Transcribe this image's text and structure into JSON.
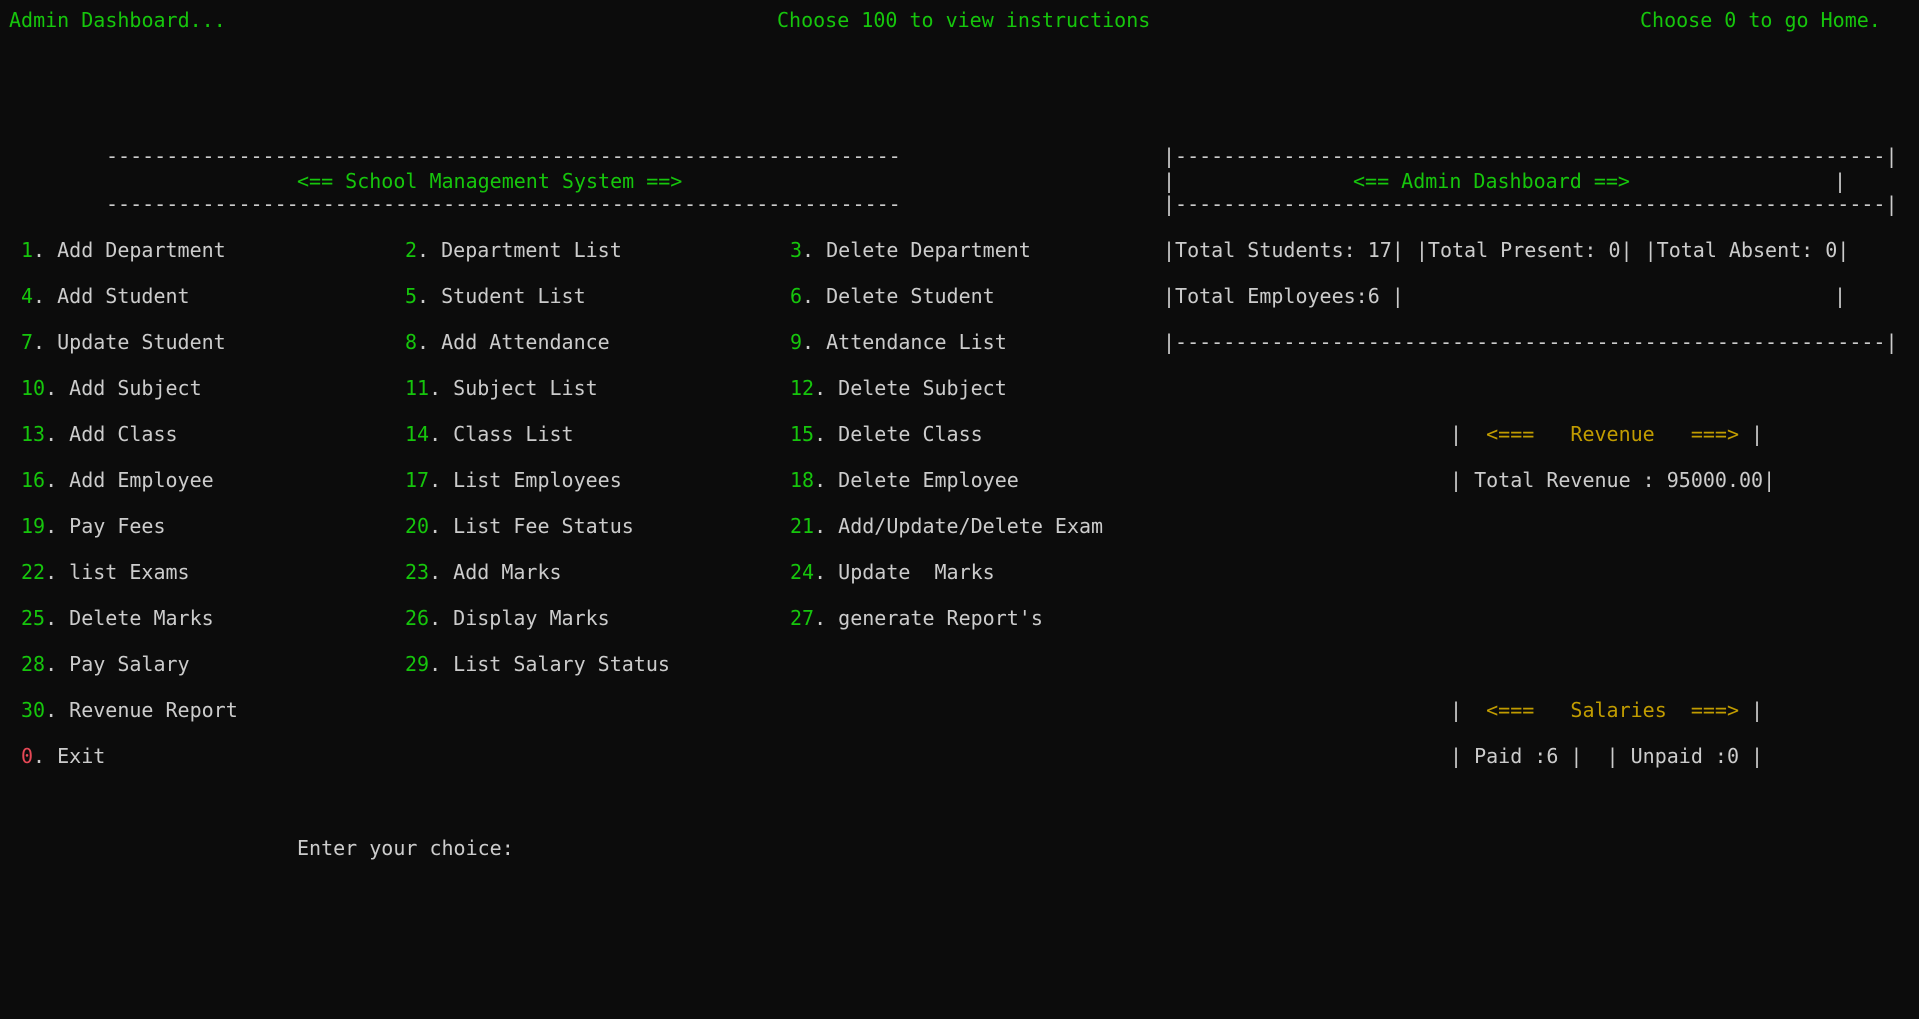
{
  "header": {
    "left": "Admin Dashboard...",
    "center": "Choose 100 to view instructions",
    "right": "Choose 0 to go Home."
  },
  "school_box": {
    "rule": "------------------------------------------------------------------",
    "title": "<== School Management System ==>"
  },
  "admin_box": {
    "rule_top": "|-----------------------------------------------------------|",
    "title_left": "|",
    "title": "<== Admin Dashboard ==>",
    "title_right": "|",
    "rule_mid": "|-----------------------------------------------------------|",
    "stats_line": "|Total Students: 17| |Total Present: 0| |Total Absent: 0|",
    "employees_line": "|Total Employees:6 |",
    "employees_right": "|",
    "rule_bottom": "|-----------------------------------------------------------|"
  },
  "menu": [
    {
      "num": "1",
      "label": ". Add Department"
    },
    {
      "num": "2",
      "label": ". Department List"
    },
    {
      "num": "3",
      "label": ". Delete Department"
    },
    {
      "num": "4",
      "label": ". Add Student"
    },
    {
      "num": "5",
      "label": ". Student List"
    },
    {
      "num": "6",
      "label": ". Delete Student"
    },
    {
      "num": "7",
      "label": ". Update Student"
    },
    {
      "num": "8",
      "label": ". Add Attendance"
    },
    {
      "num": "9",
      "label": ". Attendance List"
    },
    {
      "num": "10",
      "label": ". Add Subject"
    },
    {
      "num": "11",
      "label": ". Subject List"
    },
    {
      "num": "12",
      "label": ". Delete Subject"
    },
    {
      "num": "13",
      "label": ". Add Class"
    },
    {
      "num": "14",
      "label": ". Class List"
    },
    {
      "num": "15",
      "label": ". Delete Class"
    },
    {
      "num": "16",
      "label": ". Add Employee"
    },
    {
      "num": "17",
      "label": ". List Employees"
    },
    {
      "num": "18",
      "label": ". Delete Employee"
    },
    {
      "num": "19",
      "label": ". Pay Fees"
    },
    {
      "num": "20",
      "label": ". List Fee Status"
    },
    {
      "num": "21",
      "label": ". Add/Update/Delete Exam"
    },
    {
      "num": "22",
      "label": ". list Exams"
    },
    {
      "num": "23",
      "label": ". Add Marks"
    },
    {
      "num": "24",
      "label": ". Update  Marks"
    },
    {
      "num": "25",
      "label": ". Delete Marks"
    },
    {
      "num": "26",
      "label": ". Display Marks"
    },
    {
      "num": "27",
      "label": ". generate Report's"
    },
    {
      "num": "28",
      "label": ". Pay Salary"
    },
    {
      "num": "29",
      "label": ". List Salary Status"
    },
    {
      "num": "30",
      "label": ". Revenue Report"
    },
    {
      "num": "0",
      "label": ". Exit"
    }
  ],
  "revenue": {
    "bar_left": "| ",
    "title": " <===   Revenue   ===>",
    "bar_right": " |",
    "total_line": "| Total Revenue : 95000.00|"
  },
  "salaries": {
    "bar_left": "| ",
    "title": " <===   Salaries  ===>",
    "bar_right": " |",
    "status_line": "| Paid :6 |  | Unpaid :0 |"
  },
  "prompt": {
    "text": "Enter your choice:"
  },
  "colors": {
    "background": "#0c0c0c",
    "text": "#cccccc",
    "green": "#16c60c",
    "gold": "#c19c00",
    "red": "#e74856"
  }
}
